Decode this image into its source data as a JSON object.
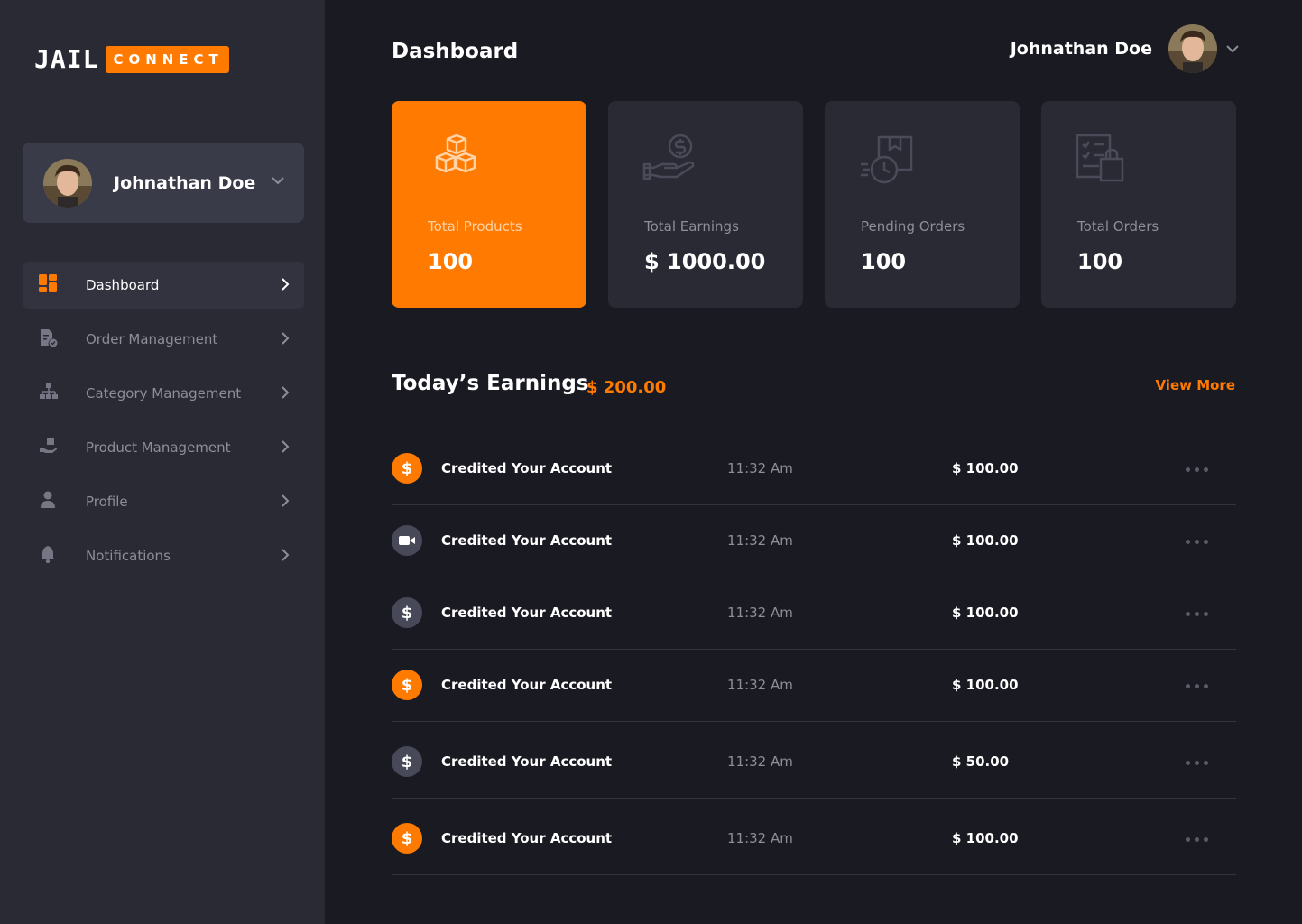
{
  "brand": {
    "logo_word": "JAIL",
    "logo_badge": "CONNECT",
    "accent": "#ff7a00"
  },
  "user": {
    "name": "Johnathan Doe",
    "avatar_icon": "user-avatar-photo",
    "menu_icon": "chevron-down-icon"
  },
  "sidebar": {
    "items": [
      {
        "label": "Dashboard",
        "icon": "dashboard-grid-icon",
        "active": true
      },
      {
        "label": "Order Management",
        "icon": "order-document-icon",
        "active": false
      },
      {
        "label": "Category Management",
        "icon": "category-tree-icon",
        "active": false
      },
      {
        "label": "Product Management",
        "icon": "product-hand-icon",
        "active": false
      },
      {
        "label": "Profile",
        "icon": "person-icon",
        "active": false
      },
      {
        "label": "Notifications",
        "icon": "bell-icon",
        "active": false
      }
    ]
  },
  "header": {
    "title": "Dashboard"
  },
  "stats": [
    {
      "label": "Total Products",
      "value": "100",
      "icon": "boxes-icon",
      "highlight": true
    },
    {
      "label": "Total Earnings",
      "value": "$ 1000.00",
      "icon": "money-hand-icon",
      "highlight": false
    },
    {
      "label": "Pending Orders",
      "value": "100",
      "icon": "pending-box-clock-icon",
      "highlight": false
    },
    {
      "label": "Total Orders",
      "value": "100",
      "icon": "order-list-bag-icon",
      "highlight": false
    }
  ],
  "earnings": {
    "title": "Today’s Earnings",
    "amount": "$ 200.00",
    "view_more": "View More"
  },
  "transactions": [
    {
      "icon": "dollar-icon",
      "style": "orange",
      "desc": "Credited Your Account",
      "time": "11:32 Am",
      "amount": "$ 100.00"
    },
    {
      "icon": "video-camera-icon",
      "style": "grey",
      "desc": "Credited Your Account",
      "time": "11:32 Am",
      "amount": "$ 100.00"
    },
    {
      "icon": "dollar-icon",
      "style": "grey",
      "desc": "Credited Your Account",
      "time": "11:32 Am",
      "amount": "$ 100.00"
    },
    {
      "icon": "dollar-icon",
      "style": "orange",
      "desc": "Credited Your Account",
      "time": "11:32 Am",
      "amount": "$ 100.00"
    },
    {
      "icon": "dollar-icon",
      "style": "grey",
      "desc": "Credited Your Account",
      "time": "11:32 Am",
      "amount": "$ 50.00"
    },
    {
      "icon": "dollar-icon",
      "style": "orange",
      "desc": "Credited Your Account",
      "time": "11:32 Am",
      "amount": "$ 100.00"
    }
  ]
}
